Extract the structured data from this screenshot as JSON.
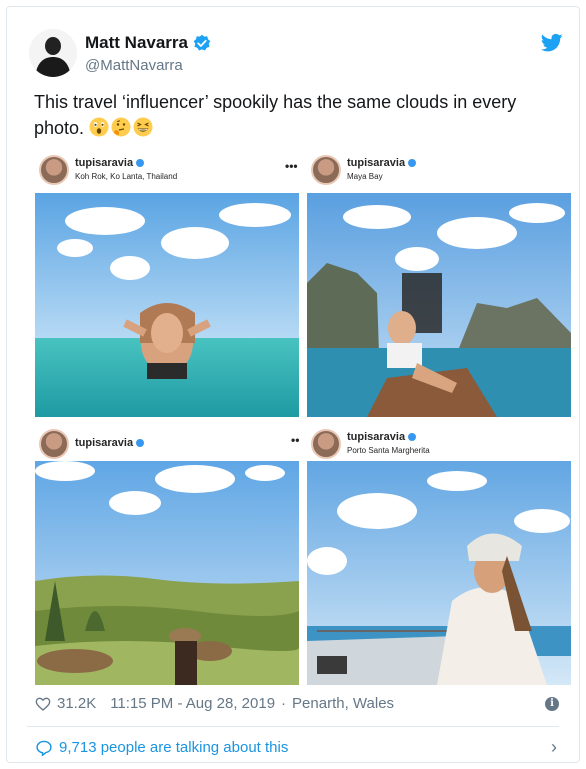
{
  "author": {
    "name": "Matt Navarra",
    "handle": "@MattNavarra"
  },
  "tweet_text": "This travel ‘influencer’ spookily has the same clouds in every photo.",
  "emojis": [
    "astonished-face",
    "thinking-face",
    "grinning-squinting-face"
  ],
  "media": {
    "posts": [
      {
        "user": "tupisaravia",
        "location": "Koh Rok, Ko Lanta, Thailand",
        "more": ""
      },
      {
        "user": "tupisaravia",
        "location": "Maya Bay",
        "more": "•••"
      },
      {
        "user": "tupisaravia",
        "location": "",
        "more": ""
      },
      {
        "user": "tupisaravia",
        "location": "Porto Santa Margherita",
        "more": "••"
      }
    ]
  },
  "footer": {
    "likes": "31.2K",
    "timestamp": "11:15 PM - Aug 28, 2019",
    "separator": "·",
    "location": "Penarth, Wales",
    "talking": "9,713 people are talking about this"
  },
  "colors": {
    "twitter_blue": "#1da1f2",
    "link_blue": "#1b95e0",
    "muted": "#657786"
  }
}
